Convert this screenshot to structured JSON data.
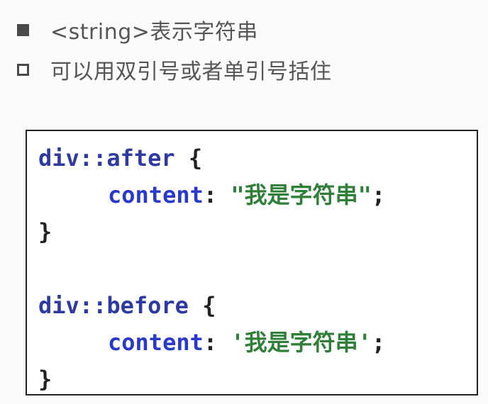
{
  "bullets": [
    {
      "marker": "filled-square",
      "text": "<string>表示字符串"
    },
    {
      "marker": "hollow-square",
      "text": "可以用双引号或者单引号括住"
    }
  ],
  "code": {
    "rule1": {
      "selector": "div::after",
      "open": " {",
      "property": "content",
      "colon": ": ",
      "value": "\"我是字符串\"",
      "semicolon": ";",
      "close": "}"
    },
    "rule2": {
      "selector": "div::before",
      "open": " {",
      "property": "content",
      "colon": ": ",
      "value": "'我是字符串'",
      "semicolon": ";",
      "close": "}"
    }
  },
  "colors": {
    "selector": "#2e3aa0",
    "property": "#2a3ac8",
    "string": "#2f7f38",
    "punctuation": "#222222",
    "bullet_text": "#555555"
  }
}
